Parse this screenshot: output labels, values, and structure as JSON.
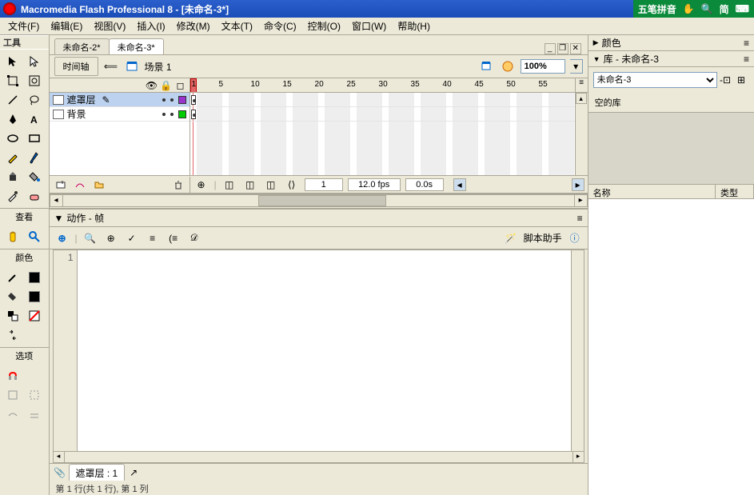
{
  "title": "Macromedia Flash Professional 8 - [未命名-3*]",
  "ime": {
    "name": "五笔拼音",
    "lang": "简"
  },
  "menu": [
    "文件(F)",
    "编辑(E)",
    "视图(V)",
    "插入(I)",
    "修改(M)",
    "文本(T)",
    "命令(C)",
    "控制(O)",
    "窗口(W)",
    "帮助(H)"
  ],
  "tools": {
    "title": "工具",
    "view_title": "查看",
    "color_title": "颜色",
    "options_title": "选项"
  },
  "docs": {
    "tabs": [
      "未命名-2*",
      "未命名-3*"
    ],
    "active": 1
  },
  "timeline_bar": {
    "timeline_btn": "时间轴",
    "scene_label": "场景 1",
    "zoom": "100%"
  },
  "ruler": {
    "marks": [
      "1",
      "5",
      "10",
      "15",
      "20",
      "25",
      "30",
      "35",
      "40",
      "45",
      "50",
      "55"
    ]
  },
  "layers": [
    {
      "name": "遮罩层",
      "selected": true,
      "color": "#9933cc"
    },
    {
      "name": "背景",
      "selected": false,
      "color": "#00cc00"
    }
  ],
  "timeline_footer": {
    "frame": "1",
    "fps": "12.0 fps",
    "time": "0.0s"
  },
  "actions": {
    "title": "动作 - 帧",
    "script_helper": "脚本助手",
    "line_no": "1",
    "tab_label": "遮罩层 : 1",
    "status": "第 1 行(共 1 行), 第 1 列"
  },
  "right": {
    "color_panel": "颜色",
    "library_panel": "库 - 未命名-3",
    "library_select": "未命名-3",
    "library_empty": "空的库",
    "col_name": "名称",
    "col_type": "类型"
  }
}
